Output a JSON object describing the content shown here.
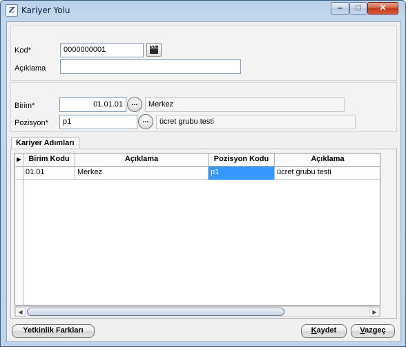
{
  "window": {
    "title": "Kariyer Yolu"
  },
  "form": {
    "kod_label": "Kod*",
    "kod_value": "0000000001",
    "aciklama_label": "Açıklama",
    "aciklama_value": "",
    "birim_label": "Birim*",
    "birim_value": "01.01.01",
    "birim_name": "Merkez",
    "pozisyon_label": "Pozisyon*",
    "pozisyon_value": "p1",
    "pozisyon_name": "ücret grubu testi",
    "ellipsis": "..."
  },
  "tab": {
    "label": "Kariyer Adımları"
  },
  "grid": {
    "columns": [
      "Birim Kodu",
      "Açıklama",
      "Pozisyon Kodu",
      "Açıklama"
    ],
    "rows": [
      {
        "birim_kodu": "01.01",
        "birim_aciklama": "Merkez",
        "pozisyon_kodu": "p1",
        "pozisyon_aciklama": "ücret grubu testi"
      }
    ]
  },
  "buttons": {
    "yetkinlik": "Yetkinlik Farkları",
    "kaydet": "Kaydet",
    "vazgec": "Vazgeç"
  }
}
